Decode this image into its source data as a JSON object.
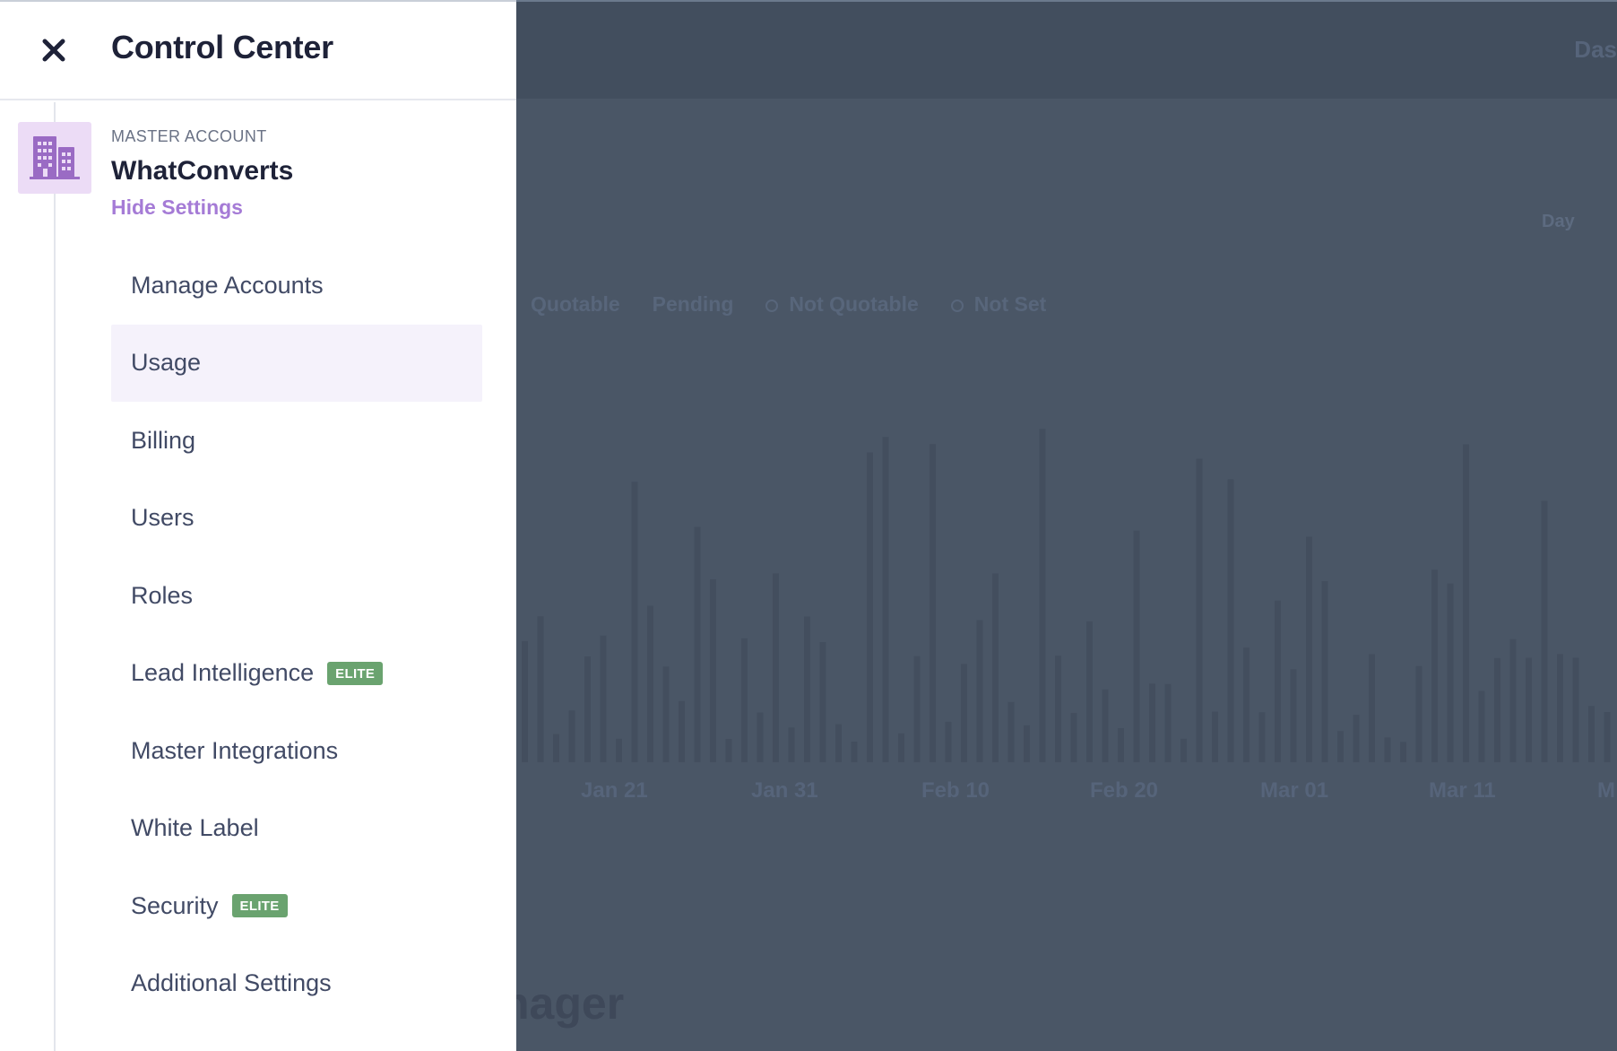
{
  "background": {
    "dash_fragment": "Das",
    "day_label": "Day",
    "legend": [
      "Quotable",
      "Pending",
      "Not Quotable",
      "Not Set"
    ],
    "x_ticks": [
      "Jan 21",
      "Jan 31",
      "Feb 10",
      "Feb 20",
      "Mar 01",
      "Mar 11",
      "M"
    ],
    "page_heading_fragment": "nager"
  },
  "drawer": {
    "title": "Control Center",
    "account": {
      "kicker": "MASTER ACCOUNT",
      "name": "WhatConverts",
      "toggle_label": "Hide Settings",
      "icon": "building-icon"
    },
    "menu": [
      {
        "label": "Manage Accounts",
        "badge": "",
        "active": false
      },
      {
        "label": "Usage",
        "badge": "",
        "active": true
      },
      {
        "label": "Billing",
        "badge": "",
        "active": false
      },
      {
        "label": "Users",
        "badge": "",
        "active": false
      },
      {
        "label": "Roles",
        "badge": "",
        "active": false
      },
      {
        "label": "Lead Intelligence",
        "badge": "ELITE",
        "active": false
      },
      {
        "label": "Master Integrations",
        "badge": "",
        "active": false
      },
      {
        "label": "White Label",
        "badge": "",
        "active": false
      },
      {
        "label": "Security",
        "badge": "ELITE",
        "active": false
      },
      {
        "label": "Additional Settings",
        "badge": "",
        "active": false
      }
    ]
  },
  "colors": {
    "overlay": "#4a5666",
    "accent": "#a57bd6",
    "badge": "#6aa36f",
    "active_item_bg": "#f5f2fb"
  }
}
